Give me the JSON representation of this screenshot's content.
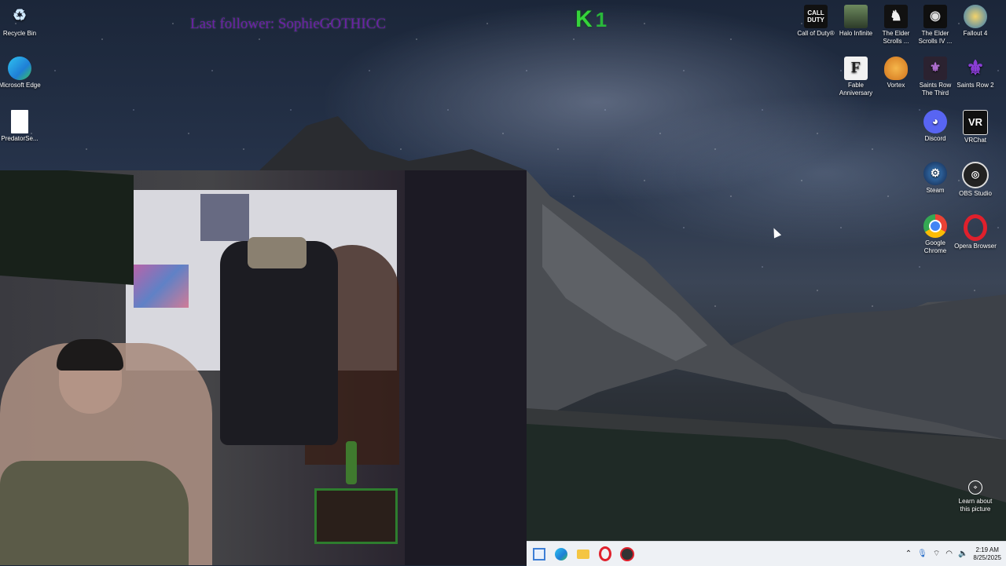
{
  "overlay": {
    "last_follower": "Last follower: SophieGOTHICC",
    "k_badge_letter": "K",
    "k_badge_count": "1"
  },
  "desktop_left": [
    {
      "label": "Recycle Bin",
      "icon": "recycle-bin-icon"
    },
    {
      "label": "Microsoft Edge",
      "icon": "edge-icon"
    },
    {
      "label": "PredatorSe...",
      "icon": "file-icon"
    }
  ],
  "desktop_right": [
    {
      "label": "Call of Duty®",
      "icon": "call-of-duty-icon"
    },
    {
      "label": "Halo Infinite",
      "icon": "halo-infinite-icon"
    },
    {
      "label": "The Elder Scrolls ...",
      "icon": "elder-scrolls-icon"
    },
    {
      "label": "The Elder Scrolls IV ...",
      "icon": "elder-scrolls-iv-icon"
    },
    {
      "label": "Fallout 4",
      "icon": "fallout-4-icon"
    },
    {
      "label": "Fable Anniversary",
      "icon": "fable-icon"
    },
    {
      "label": "Vortex",
      "icon": "vortex-icon"
    },
    {
      "label": "Saints Row The Third",
      "icon": "saints-row-third-icon"
    },
    {
      "label": "Saints Row 2",
      "icon": "saints-row-2-icon"
    },
    {
      "label": "Discord",
      "icon": "discord-icon"
    },
    {
      "label": "VRChat",
      "icon": "vrchat-icon"
    },
    {
      "label": "Steam",
      "icon": "steam-icon"
    },
    {
      "label": "OBS Studio",
      "icon": "obs-studio-icon"
    },
    {
      "label": "Google Chrome",
      "icon": "chrome-icon"
    },
    {
      "label": "Opera Browser",
      "icon": "opera-icon"
    }
  ],
  "learn_picture": "Learn about this picture",
  "taskbar": {
    "apps": [
      "task-view-icon",
      "edge-icon",
      "file-explorer-icon",
      "opera-icon",
      "app-icon"
    ],
    "time": "2:19 AM",
    "date": "8/25/2025"
  },
  "colors": {
    "overlay_text": "#6a1fa6",
    "k_badge": "#35d43a",
    "taskbar_bg": "#eef1f5"
  }
}
